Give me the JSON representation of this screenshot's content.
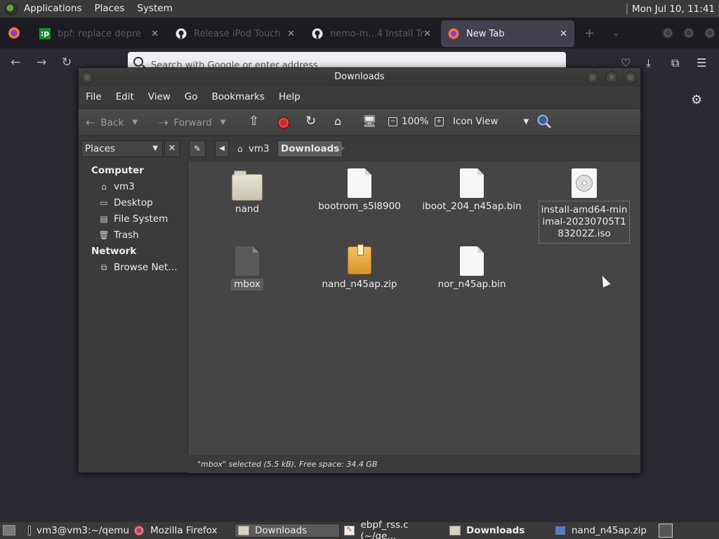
{
  "top_panel": {
    "menus": [
      "Applications",
      "Places",
      "System"
    ],
    "clock": "Mon Jul 10, 11:41"
  },
  "firefox": {
    "tabs": [
      {
        "title": "bpf: replace depre",
        "icon": "pastebin-icon",
        "state": "dim"
      },
      {
        "title": "Release iPod Touch",
        "icon": "github-icon",
        "state": "dim"
      },
      {
        "title": "nemo-m...4 Install Tr",
        "icon": "github-icon",
        "state": "dim"
      },
      {
        "title": "New Tab",
        "icon": "firefox-icon",
        "state": "active"
      }
    ],
    "url_placeholder": "Search with Google or enter address"
  },
  "caja": {
    "window_title": "Downloads",
    "menus": [
      "File",
      "Edit",
      "View",
      "Go",
      "Bookmarks",
      "Help"
    ],
    "toolbar": {
      "back": "Back",
      "forward": "Forward",
      "zoom": "100%",
      "view_mode": "Icon View"
    },
    "sidebar_select": "Places",
    "breadcrumbs": [
      "vm3",
      "Downloads"
    ],
    "sidebar": {
      "computer_heading": "Computer",
      "computer_items": [
        {
          "label": "vm3",
          "icon": "home-folder-icon"
        },
        {
          "label": "Desktop",
          "icon": "desktop-icon"
        },
        {
          "label": "File System",
          "icon": "drive-icon"
        },
        {
          "label": "Trash",
          "icon": "trash-icon"
        }
      ],
      "network_heading": "Network",
      "network_items": [
        {
          "label": "Browse Net…",
          "icon": "network-icon"
        }
      ]
    },
    "files": [
      {
        "name": "nand",
        "type": "folder"
      },
      {
        "name": "bootrom_s5l8900",
        "type": "file"
      },
      {
        "name": "iboot_204_n45ap.bin",
        "type": "file"
      },
      {
        "name": "install-amd64-minimal-20230705T183202Z.iso",
        "type": "iso"
      },
      {
        "name": "mbox",
        "type": "mbox",
        "selected": true
      },
      {
        "name": "nand_n45ap.zip",
        "type": "zip"
      },
      {
        "name": "nor_n45ap.bin",
        "type": "file"
      }
    ],
    "status": "\"mbox\" selected (5.5 kB), Free space: 34.4 GB"
  },
  "taskbar": {
    "tasks": [
      {
        "label": "vm3@vm3:~/qemu",
        "icon": "terminal-icon"
      },
      {
        "label": "Mozilla Firefox",
        "icon": "firefox-icon"
      },
      {
        "label": "Downloads",
        "icon": "folder-icon",
        "state": "active"
      },
      {
        "label": "ebpf_rss.c (~/qe...",
        "icon": "text-editor-icon"
      },
      {
        "label": "Downloads",
        "icon": "folder-icon",
        "state": "bold"
      },
      {
        "label": "nand_n45ap.zip",
        "icon": "archive-icon"
      }
    ]
  }
}
